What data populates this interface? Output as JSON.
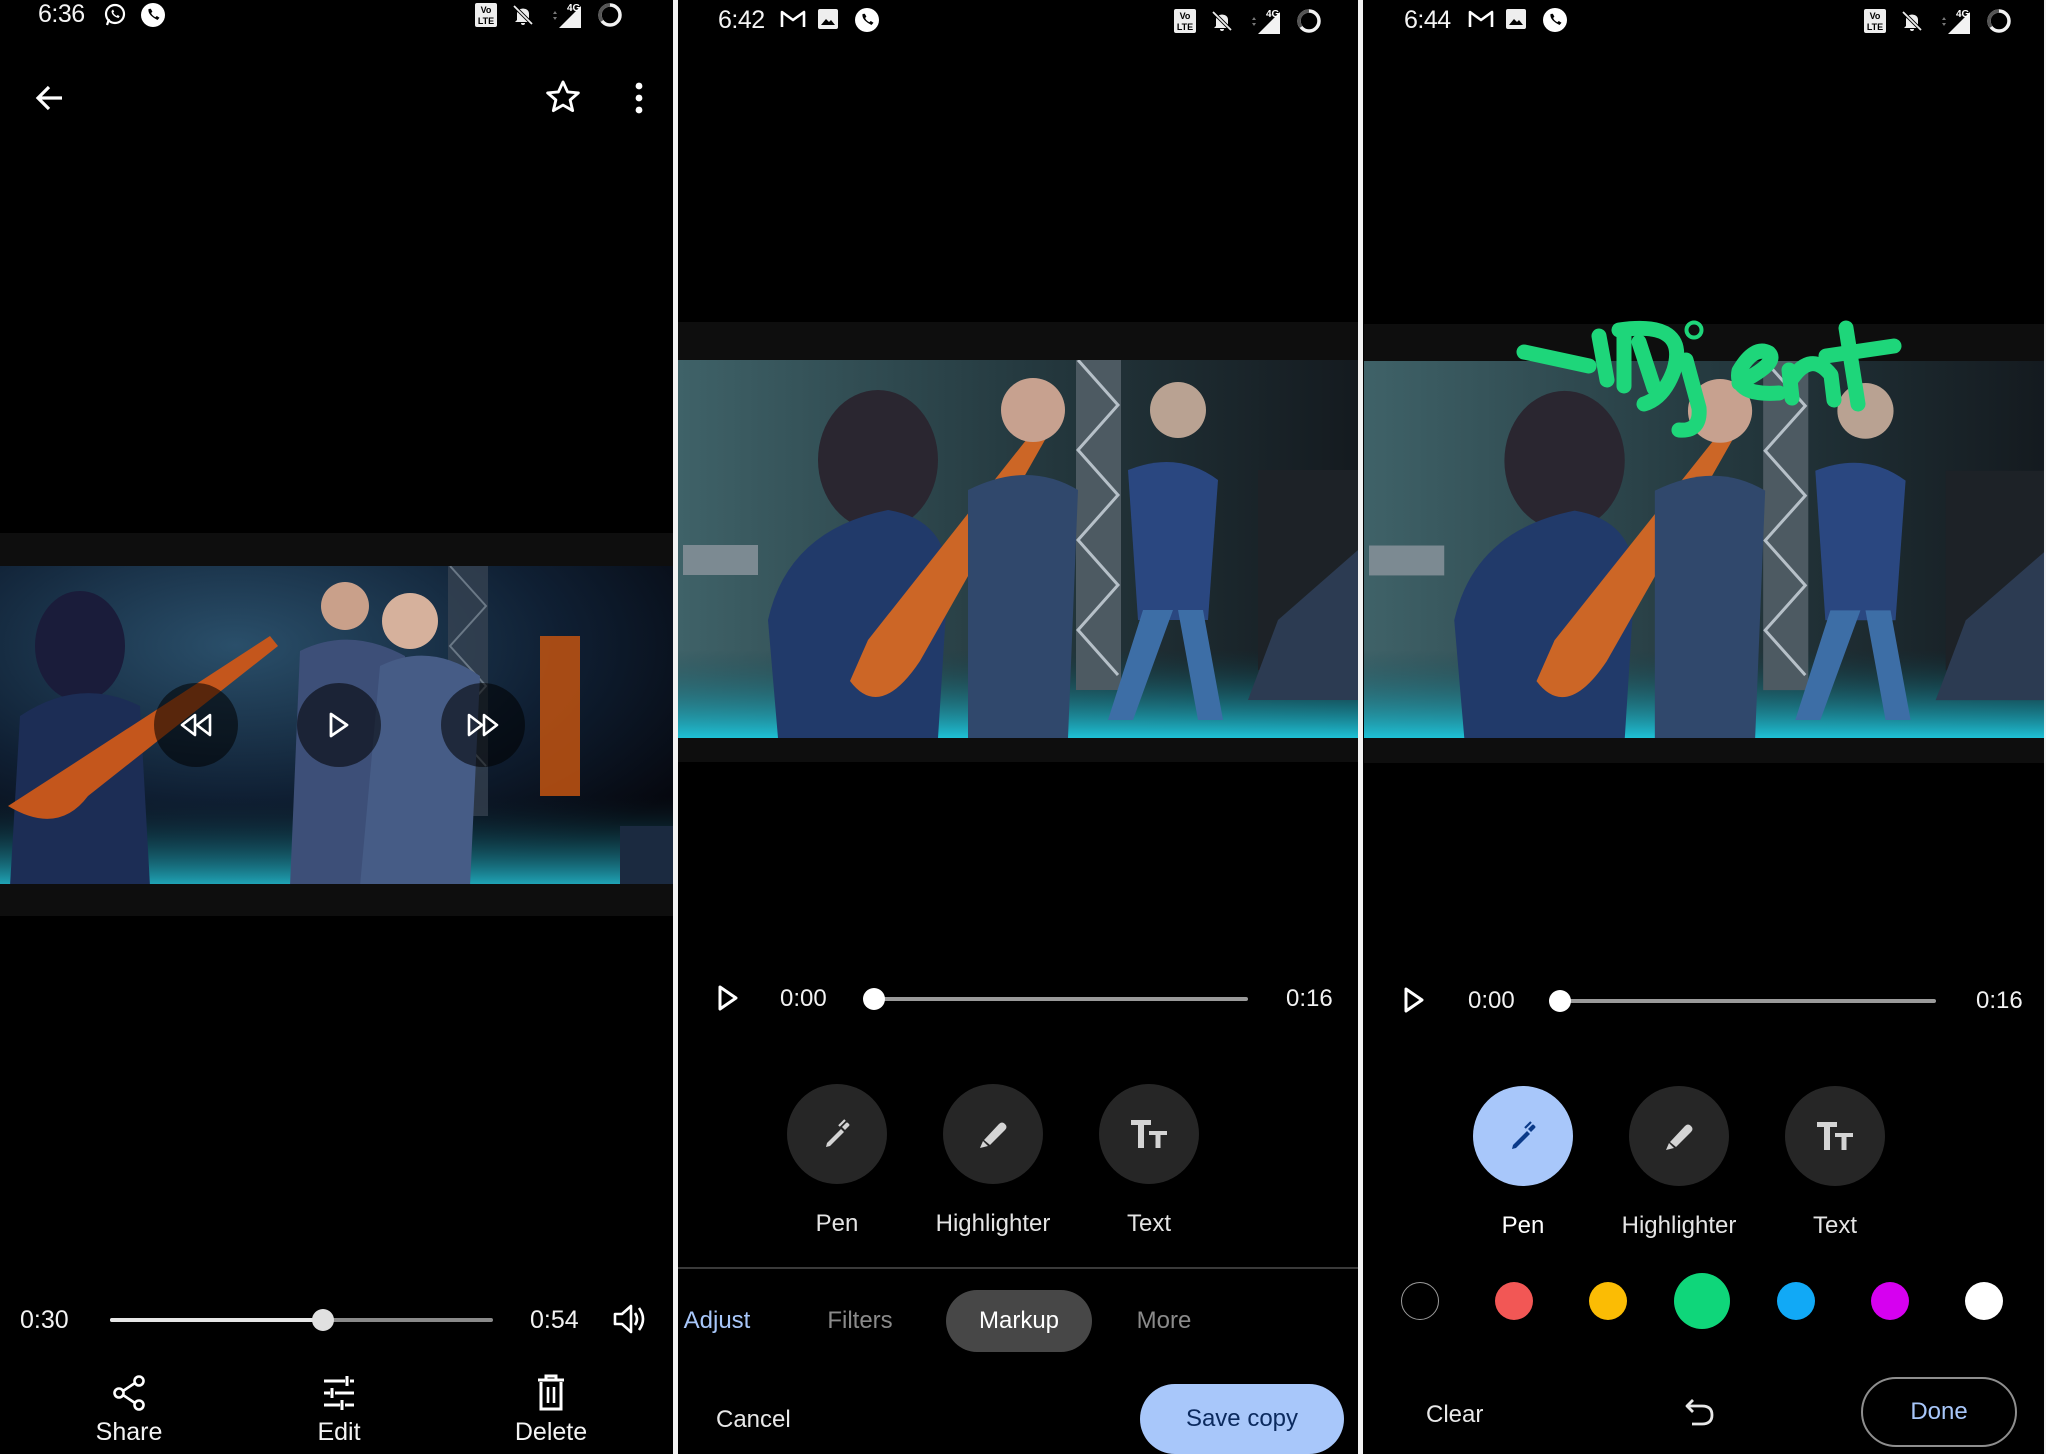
{
  "panels": [
    {
      "id": "viewer",
      "status_bar": {
        "time": "6:36",
        "left_icons": [
          "whatsapp-icon",
          "phone-call-icon"
        ],
        "right_icons": [
          "volte-icon",
          "bell-off-icon",
          "signal-4g-icon",
          "battery-ring-icon"
        ],
        "network_label": "4G",
        "volte_label": "Vo LTE"
      },
      "top_bar": {
        "back_icon": "arrow-left-icon",
        "favorite_icon": "star-outline-icon",
        "menu_icon": "more-vert-icon"
      },
      "overlay_controls": [
        "rewind-icon",
        "play-icon",
        "fast-forward-icon"
      ],
      "playback": {
        "current": "0:30",
        "total": "0:54",
        "progress": 0.556,
        "volume_icon": "volume-icon"
      },
      "actions": [
        {
          "label": "Share",
          "icon": "share-icon"
        },
        {
          "label": "Edit",
          "icon": "tune-sliders-icon"
        },
        {
          "label": "Delete",
          "icon": "trash-icon"
        }
      ]
    },
    {
      "id": "editor-markup",
      "status_bar": {
        "time": "6:42",
        "left_icons": [
          "gmail-icon",
          "image-icon",
          "phone-call-icon"
        ],
        "right_icons": [
          "volte-icon",
          "bell-off-icon",
          "signal-4g-icon",
          "battery-ring-icon"
        ],
        "network_label": "4G",
        "volte_label": "Vo LTE"
      },
      "playback": {
        "current": "0:00",
        "total": "0:16",
        "progress": 0.0
      },
      "tools": [
        {
          "label": "Pen",
          "icon": "pen-icon",
          "active": false
        },
        {
          "label": "Highlighter",
          "icon": "highlighter-icon",
          "active": false
        },
        {
          "label": "Text",
          "icon": "text-format-icon",
          "active": false
        }
      ],
      "tabs": [
        {
          "label": "Adjust",
          "active": false
        },
        {
          "label": "Filters",
          "active": false
        },
        {
          "label": "Markup",
          "active": true
        },
        {
          "label": "More",
          "active": false
        }
      ],
      "cancel_label": "Cancel",
      "save_label": "Save copy"
    },
    {
      "id": "editor-pen",
      "status_bar": {
        "time": "6:44",
        "left_icons": [
          "gmail-icon",
          "image-icon",
          "phone-call-icon"
        ],
        "right_icons": [
          "volte-icon",
          "bell-off-icon",
          "signal-4g-icon",
          "battery-ring-icon"
        ],
        "network_label": "4G",
        "volte_label": "Vo LTE"
      },
      "annotation_text": "#Djent",
      "annotation_color": "#1ed67a",
      "playback": {
        "current": "0:00",
        "total": "0:16",
        "progress": 0.0
      },
      "tools": [
        {
          "label": "Pen",
          "icon": "pen-icon",
          "active": true
        },
        {
          "label": "Highlighter",
          "icon": "highlighter-icon",
          "active": false
        },
        {
          "label": "Text",
          "icon": "text-format-icon",
          "active": false
        }
      ],
      "colors": [
        {
          "name": "black",
          "hex": "#000000",
          "selected": false
        },
        {
          "name": "red",
          "hex": "#f25755",
          "selected": false
        },
        {
          "name": "yellow",
          "hex": "#fbbc04",
          "selected": false
        },
        {
          "name": "green",
          "hex": "#0fd67a",
          "selected": true
        },
        {
          "name": "blue",
          "hex": "#11a9f6",
          "selected": false
        },
        {
          "name": "purple",
          "hex": "#d600f0",
          "selected": false
        },
        {
          "name": "white",
          "hex": "#ffffff",
          "selected": false
        }
      ],
      "clear_label": "Clear",
      "undo_icon": "undo-icon",
      "done_label": "Done"
    }
  ],
  "theme": {
    "accent": "#a8c7fa",
    "accent_text": "#0b2a5e",
    "tool_bg": "#262626",
    "tab_active_bg": "#474747"
  }
}
